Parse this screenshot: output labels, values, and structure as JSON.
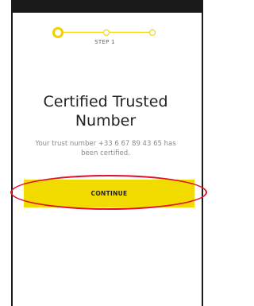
{
  "stepper": {
    "label": "STEP 1",
    "accent": "#f0d000",
    "current_step": 1,
    "total_steps": 3
  },
  "content": {
    "title": "Certified Trusted Number",
    "subtitle": "Your trust number +33 6 67 89 43 65 has been certified."
  },
  "actions": {
    "continue_label": "CONTINUE",
    "continue_color": "#f2dc00"
  },
  "annotation": {
    "color": "#e0102a"
  }
}
